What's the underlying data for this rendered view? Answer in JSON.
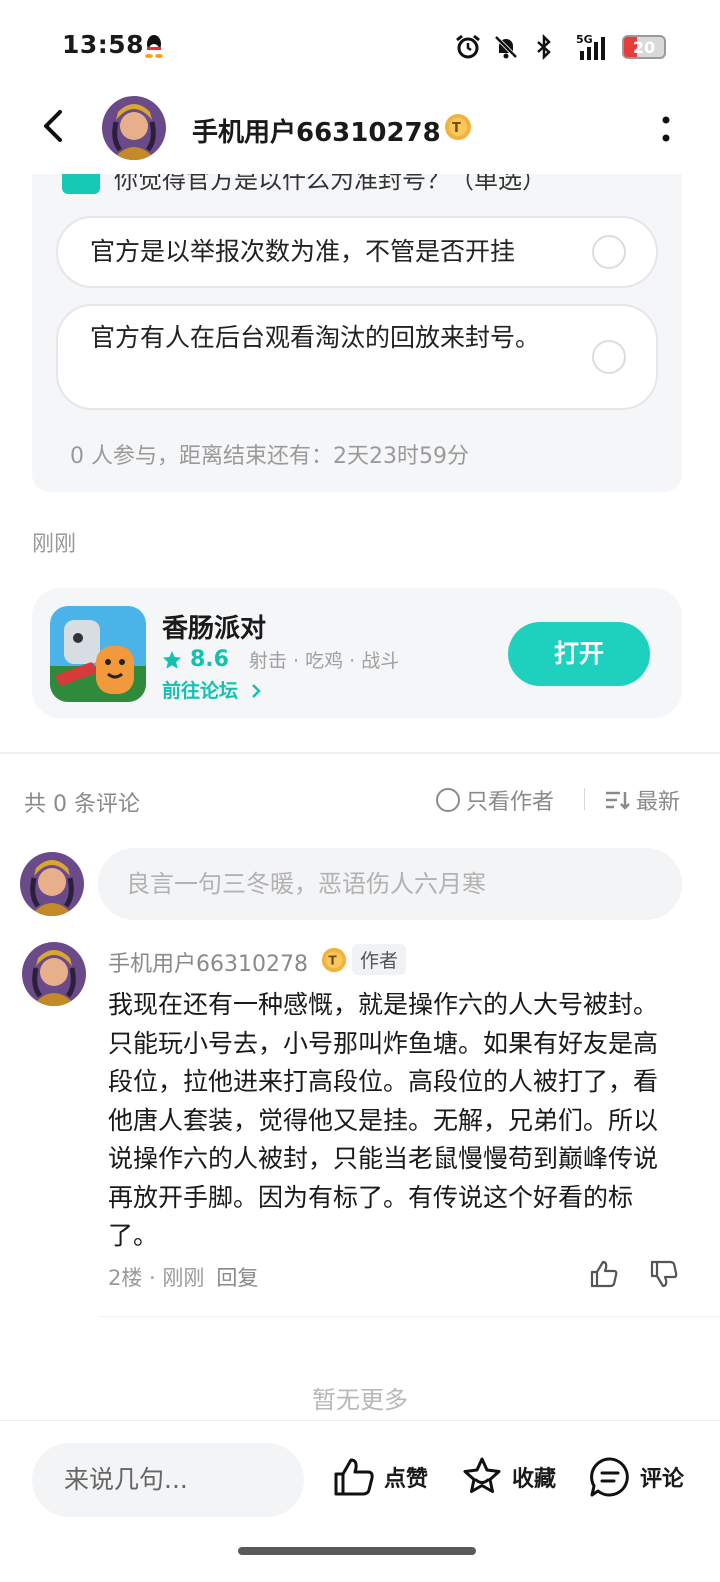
{
  "status_bar": {
    "time": "13:58",
    "network": "5G",
    "battery": "20",
    "battery_color": "#e83b3b"
  },
  "header": {
    "username": "手机用户66310278"
  },
  "poll": {
    "question": "你觉得官方是以什么为准封号？（单选）",
    "options": [
      "官方是以举报次数为准，不管是否开挂",
      "官方有人在后台观看淘汰的回放来封号。"
    ],
    "meta": "0 人参与，距离结束还有：2天23时59分",
    "accent": "#15c9b7"
  },
  "post": {
    "time": "刚刚"
  },
  "game": {
    "name": "香肠派对",
    "score": "8.6",
    "tags": "射击 · 吃鸡 · 战斗",
    "forum_link": "前往论坛",
    "open_label": "打开",
    "accent": "#1ed1bf"
  },
  "comments": {
    "count_label": "共 0 条评论",
    "only_author_label": "只看作者",
    "sort_label": "最新",
    "input_placeholder": "良言一句三冬暖，恶语伤人六月寒",
    "items": [
      {
        "username": "手机用户66310278",
        "author_tag": "作者",
        "body": "我现在还有一种感慨，就是操作六的人大号被封。只能玩小号去，小号那叫炸鱼塘。如果有好友是高段位，拉他进来打高段位。高段位的人被打了，看他唐人套装，觉得他又是挂。无解，兄弟们。所以说操作六的人被封，只能当老鼠慢慢苟到巅峰传说再放开手脚。因为有标了。有传说这个好看的标了。",
        "floor": "2楼 · 刚刚",
        "reply_label": "回复"
      }
    ],
    "no_more": "暂无更多"
  },
  "bottom_bar": {
    "input_placeholder": "来说几句...",
    "like_label": "点赞",
    "favorite_label": "收藏",
    "comment_label": "评论"
  }
}
